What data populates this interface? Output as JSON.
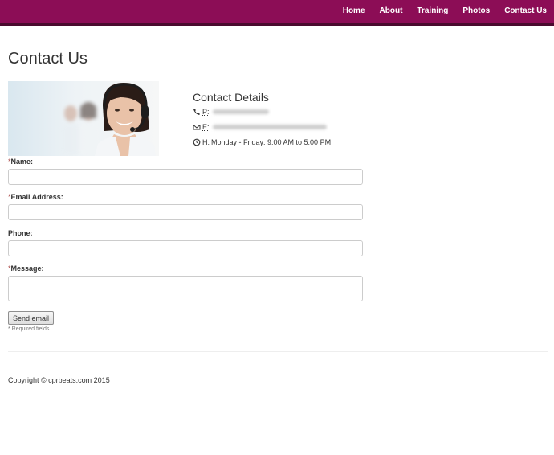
{
  "nav": {
    "items": [
      {
        "label": "Home"
      },
      {
        "label": "About"
      },
      {
        "label": "Training"
      },
      {
        "label": "Photos"
      },
      {
        "label": "Contact Us"
      }
    ]
  },
  "page": {
    "title": "Contact Us"
  },
  "contact": {
    "heading": "Contact Details",
    "phone_abbr": "P:",
    "email_abbr": "E:",
    "hours_abbr": "H:",
    "hours_value": "Monday - Friday: 9:00 AM to 5:00 PM"
  },
  "form": {
    "name_label": "Name:",
    "email_label": "Email Address:",
    "phone_label": "Phone:",
    "message_label": "Message:",
    "required_mark": "*",
    "send_label": "Send email",
    "required_note": "* Required fields"
  },
  "footer": {
    "copyright": "Copyright © cprbeats.com 2015"
  },
  "colors": {
    "navbar": "#8c0d56",
    "navbar_border": "#4a0a2e"
  },
  "icons": [
    "phone-icon",
    "envelope-icon",
    "clock-icon",
    "headset-support-photo"
  ]
}
